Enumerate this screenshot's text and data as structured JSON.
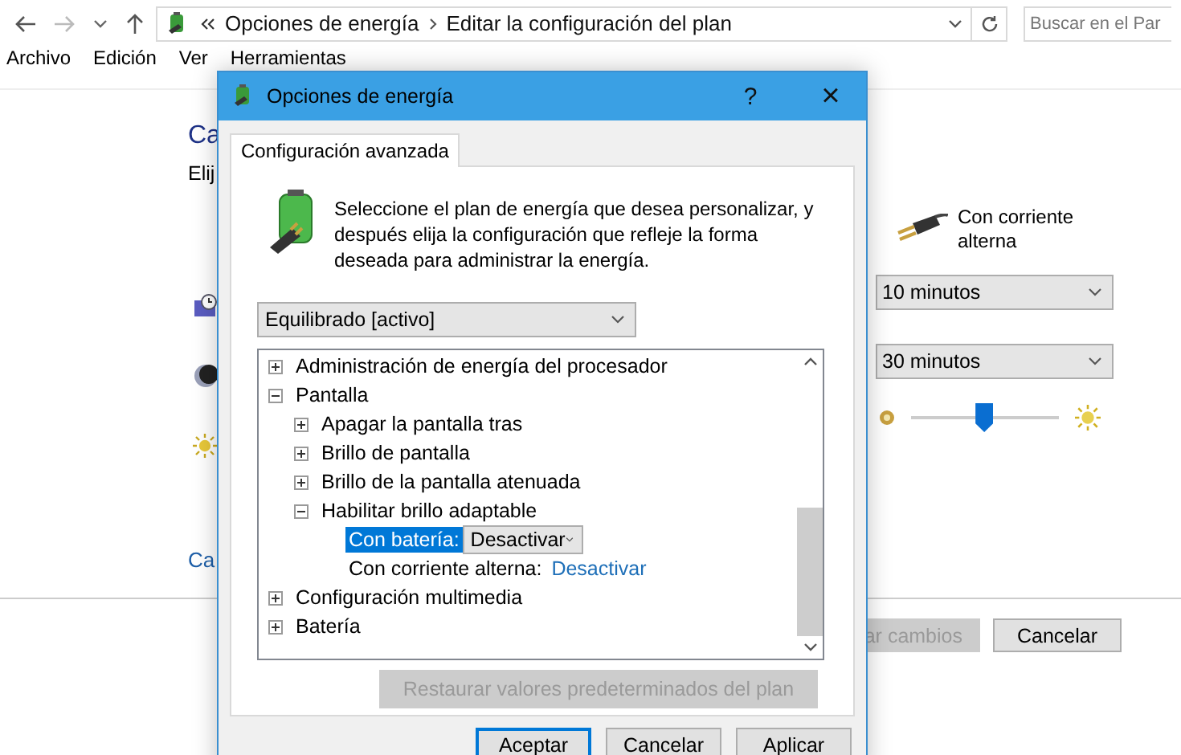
{
  "explorer": {
    "breadcrumb": [
      "Opciones de energía",
      "Editar la configuración del plan"
    ],
    "search": {
      "placeholder": "Buscar en el Par"
    },
    "menu": [
      "Archivo",
      "Edición",
      "Ver",
      "Herramientas"
    ],
    "left": {
      "heading": "Ca",
      "subtitle": "Elij",
      "link": "Ca"
    },
    "right": {
      "column_title": "Con corriente alterna",
      "dropdowns": [
        "10 minutos",
        "30 minutos"
      ],
      "brightness": {
        "level": 0.49
      }
    },
    "buttons": [
      {
        "label": "ar cambios",
        "disabled": true
      },
      {
        "label": "Cancelar",
        "disabled": false
      }
    ]
  },
  "dialog": {
    "title": "Opciones de energía",
    "help": "?",
    "close": "×",
    "tabs": [
      {
        "label": "Configuración avanzada",
        "selected": true
      }
    ],
    "description": "Seleccione el plan de energía que desea personalizar, y después elija la configuración que refleje la forma deseada para administrar la energía.",
    "plan": "Equilibrado [activo]",
    "tree": [
      {
        "label": "Administración de energía del procesador",
        "expanded": false
      },
      {
        "label": "Pantalla",
        "expanded": true,
        "children": [
          {
            "label": "Apagar la pantalla tras",
            "expanded": false
          },
          {
            "label": "Brillo de pantalla",
            "expanded": false
          },
          {
            "label": "Brillo de la pantalla atenuada",
            "expanded": false
          },
          {
            "label": "Habilitar brillo adaptable",
            "expanded": true,
            "settings": [
              {
                "kind": "dropdown",
                "label": "Con batería:",
                "value": "Desactivar",
                "selected": true
              },
              {
                "kind": "link",
                "label": "Con corriente alterna:",
                "value": "Desactivar",
                "selected": false
              }
            ]
          }
        ]
      },
      {
        "label": "Configuración multimedia",
        "expanded": false
      },
      {
        "label": "Batería",
        "expanded": false
      }
    ],
    "restore": {
      "label": "Restaurar valores predeterminados del plan",
      "disabled": true
    },
    "buttons": [
      {
        "label": "Aceptar",
        "default": true
      },
      {
        "label": "Cancelar",
        "default": false
      },
      {
        "label": "Aplicar",
        "default": false
      }
    ]
  }
}
